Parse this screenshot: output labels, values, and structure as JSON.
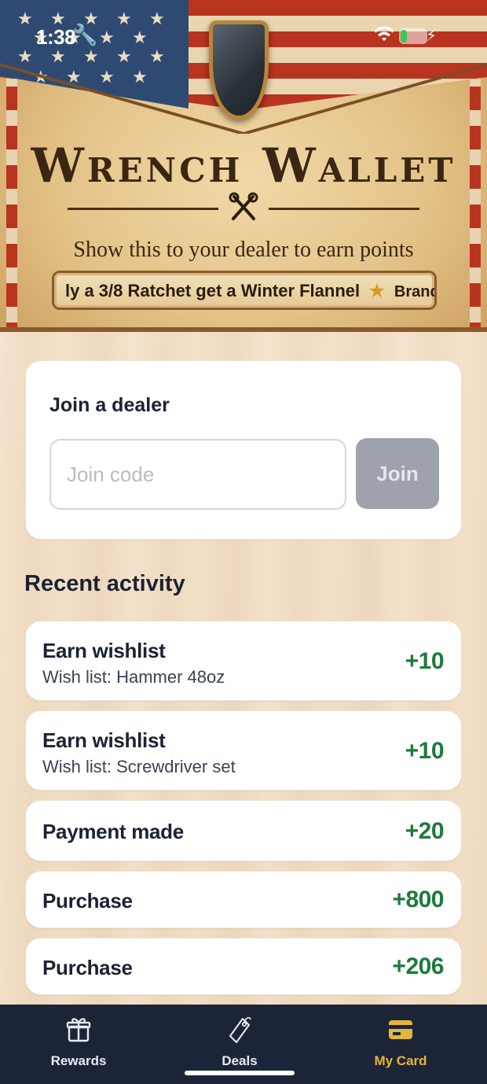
{
  "status_bar": {
    "time": "1:38",
    "icons": [
      "wrench-icon",
      "wifi-icon",
      "battery-icon",
      "charging-bolt-icon"
    ],
    "battery_level": 0.25
  },
  "header": {
    "brand_title": "Wrench Wallet",
    "tagline": "Show this to your dealer to earn points",
    "ticker": {
      "item1": "ly a 3/8 Ratchet get a Winter Flannel",
      "separator": "★",
      "item2": "Brand Name ... Bt"
    }
  },
  "join": {
    "title": "Join a dealer",
    "placeholder": "Join code",
    "button_label": "Join"
  },
  "activity": {
    "title": "Recent activity",
    "items": [
      {
        "title": "Earn wishlist",
        "subtitle": "Wish list: Hammer 48oz",
        "points": "+10"
      },
      {
        "title": "Earn wishlist",
        "subtitle": "Wish list: Screwdriver set",
        "points": "+10"
      },
      {
        "title": "Payment made",
        "subtitle": "",
        "points": "+20"
      },
      {
        "title": "Purchase",
        "subtitle": "",
        "points": "+800"
      },
      {
        "title": "Purchase",
        "subtitle": "",
        "points": "+206"
      }
    ]
  },
  "nav": {
    "items": [
      {
        "label": "Rewards",
        "icon": "gift-icon",
        "active": false
      },
      {
        "label": "Deals",
        "icon": "tag-icon",
        "active": false
      },
      {
        "label": "My Card",
        "icon": "card-icon",
        "active": true
      }
    ],
    "active_color": "#e5b43a"
  },
  "colors": {
    "points_green": "#1e7a3c",
    "nav_background": "#1c2538",
    "join_button_disabled": "#9da2ac"
  }
}
